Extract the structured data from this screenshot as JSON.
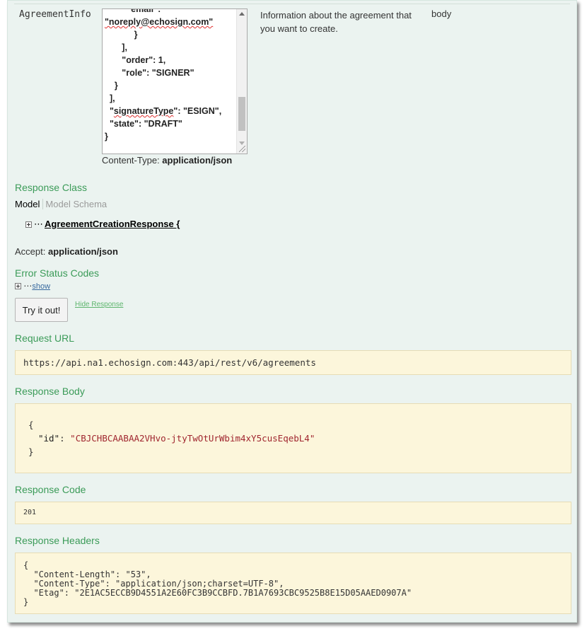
{
  "param": {
    "name": "AgreementInfo",
    "textarea_lines": [
      {
        "pre": "         ",
        "text": "\"email\":"
      },
      {
        "pre": "",
        "text": "\"noreply@echosign.com\"",
        "squiggle": true
      },
      {
        "pre": "            ",
        "text": "}"
      },
      {
        "pre": "       ",
        "text": "],"
      },
      {
        "pre": "       ",
        "text": "\"order\": 1,"
      },
      {
        "pre": "       ",
        "text": "\"role\": \"SIGNER\""
      },
      {
        "pre": "    ",
        "text": "}"
      },
      {
        "pre": "  ",
        "text": "],"
      },
      {
        "pre": "  ",
        "text": "\"signatureType\": \"ESIGN\",",
        "squiggle_word": "signatureType"
      },
      {
        "pre": "  ",
        "text": "\"state\": \"DRAFT\""
      },
      {
        "pre": "",
        "text": "}"
      }
    ],
    "content_type_label": "Content-Type:",
    "content_type_value": "application/json",
    "description": "Information about the agreement that you want to create.",
    "param_type": "body"
  },
  "response_class": {
    "title": "Response Class",
    "tab_model": "Model",
    "tab_schema": "Model Schema",
    "model_name": "AgreementCreationResponse {",
    "dots": "⋯"
  },
  "accept": {
    "label": "Accept:",
    "value": "application/json"
  },
  "error_codes": {
    "title": "Error Status Codes",
    "dots": "⋯",
    "show_link": "show"
  },
  "actions": {
    "try_button": "Try it out!",
    "hide_link": "Hide Response"
  },
  "request_url": {
    "title": "Request URL",
    "value": "https://api.na1.echosign.com:443/api/rest/v6/agreements"
  },
  "response_body": {
    "title": "Response Body",
    "open": "{",
    "key": "\"id\"",
    "sep": ": ",
    "value": "\"CBJCHBCAABAA2VHvo-jtyTwOtUrWbim4xY5cusEqebL4\"",
    "close": "}"
  },
  "response_code": {
    "title": "Response Code",
    "value": "201"
  },
  "response_headers": {
    "title": "Response Headers",
    "text": "{\n  \"Content-Length\": \"53\",\n  \"Content-Type\": \"application/json;charset=UTF-8\",\n  \"Etag\": \"2E1AC5ECCB9D4551A2E60FC3B9CCBFD.7B1A7693CBC9525B8E15D05AAED0907A\"\n}"
  },
  "colors": {
    "panel_bg": "#ebf3f0",
    "section_title": "#3b9b58",
    "code_bg": "#fcf6db",
    "string_red": "#a0262f"
  }
}
